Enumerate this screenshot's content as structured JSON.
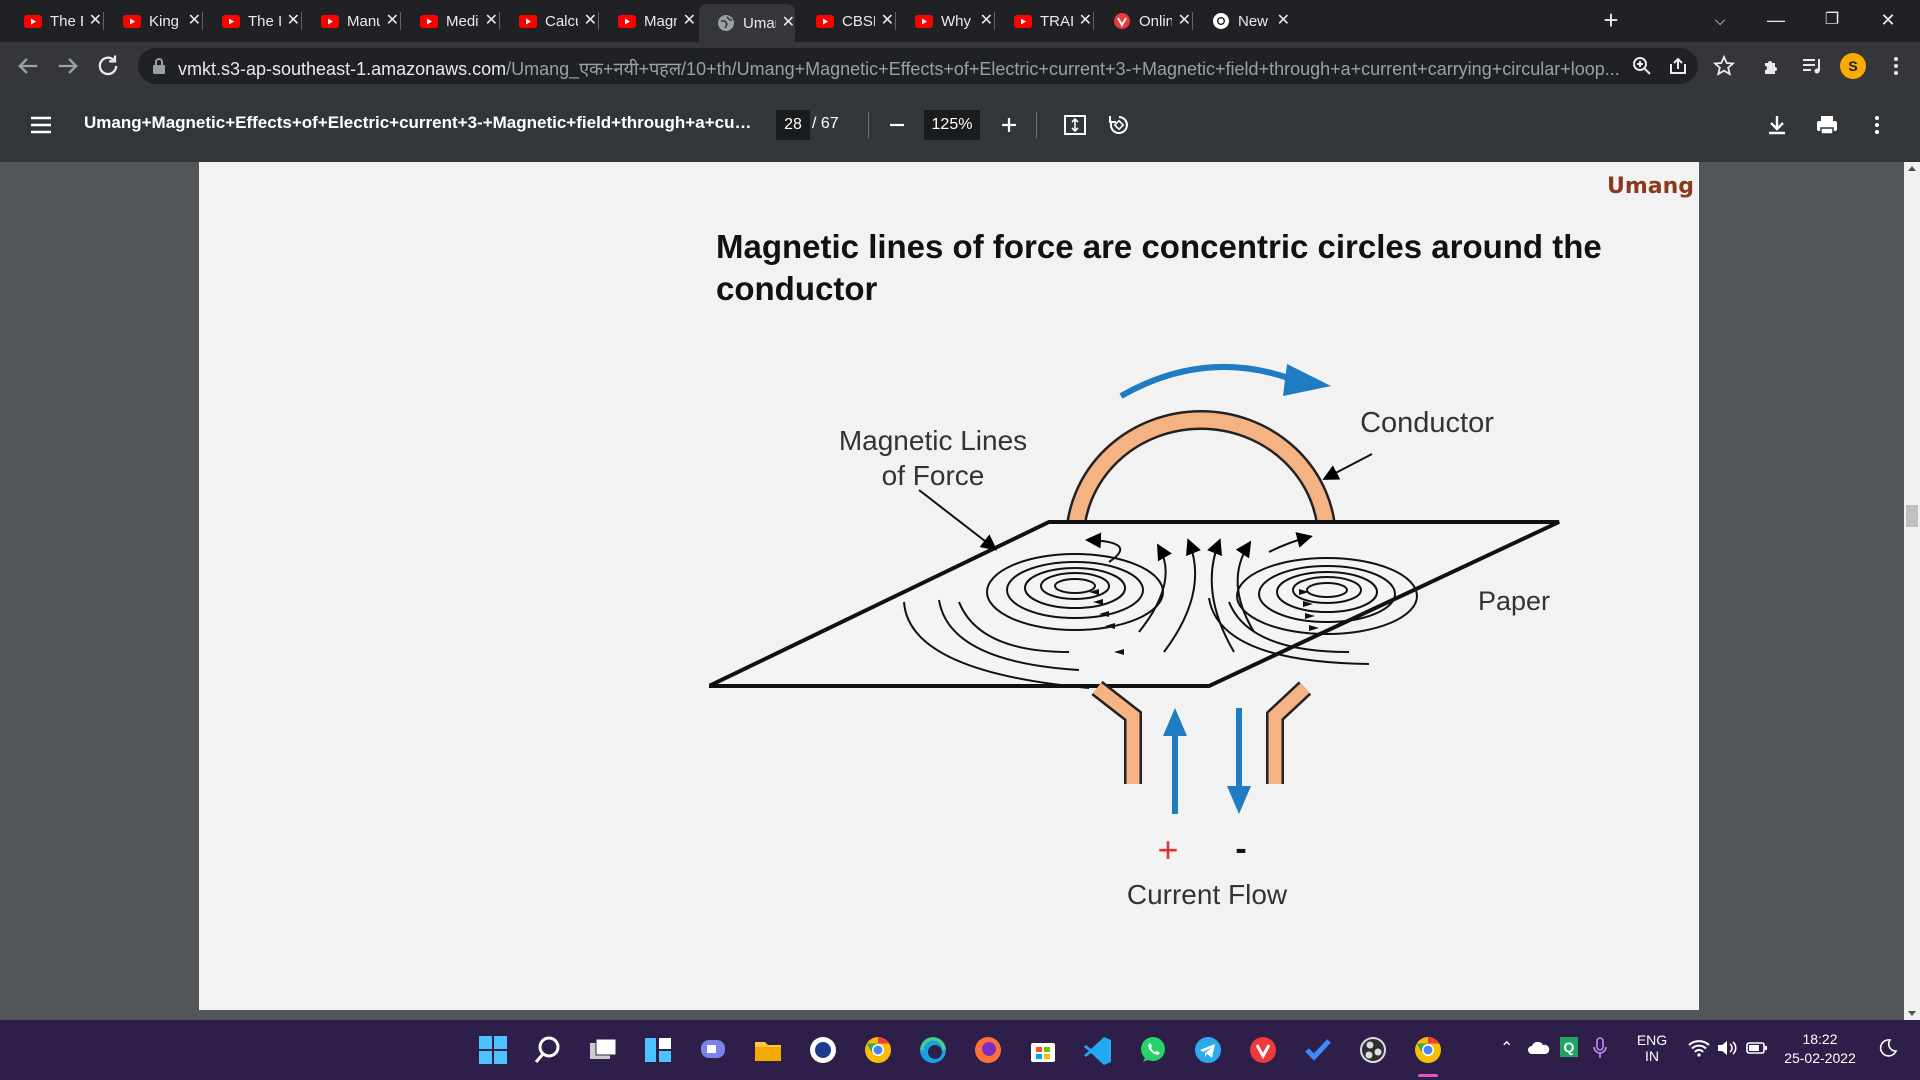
{
  "tabs": [
    {
      "title": "The Bi",
      "favicon": "youtube-icon"
    },
    {
      "title": "King K",
      "favicon": "youtube-icon"
    },
    {
      "title": "The In",
      "favicon": "youtube-icon"
    },
    {
      "title": "Manu",
      "favicon": "youtube-icon"
    },
    {
      "title": "Medit",
      "favicon": "youtube-icon"
    },
    {
      "title": "Calcul",
      "favicon": "youtube-icon"
    },
    {
      "title": "Magn",
      "favicon": "youtube-icon"
    },
    {
      "title": "Umang",
      "favicon": "globe-icon",
      "active": true
    },
    {
      "title": "CBSE",
      "favicon": "youtube-icon"
    },
    {
      "title": "Why A",
      "favicon": "youtube-icon"
    },
    {
      "title": "TRAIL",
      "favicon": "youtube-icon"
    },
    {
      "title": "Online",
      "favicon": "vivaldi-icon"
    },
    {
      "title": "New T",
      "favicon": "chrome-icon"
    }
  ],
  "address": {
    "host": "vmkt.s3-ap-southeast-1.amazonaws.com",
    "path": "/Umang_एक+नयी+पहल/10+th/Umang+Magnetic+Effects+of+Electric+current+3-+Magnetic+field+through+a+current+carrying+circular+loop..."
  },
  "profile": {
    "initial": "S"
  },
  "pdf": {
    "title": "Umang+Magnetic+Effects+of+Electric+current+3-+Magnetic+field+through+a+curre...",
    "current_page": "28",
    "total_pages": "/  67",
    "zoom": "125%"
  },
  "slide": {
    "logo": "Umang",
    "title": "Magnetic lines of force are concentric circles around the conductor",
    "diagram": {
      "label_lines": "Magnetic Lines of Force",
      "label_lines_1": "Magnetic Lines",
      "label_lines_2": "of Force",
      "label_conductor": "Conductor",
      "label_paper": "Paper",
      "plus": "+",
      "minus": "-",
      "label_current": "Current Flow"
    }
  },
  "colors": {
    "accent_orange": "#f5b383",
    "arrow_blue": "#1f7bc2",
    "taskbar": "#2d1f4a"
  },
  "system_tray": {
    "language": "ENG",
    "region": "IN",
    "time": "18:22",
    "date": "25-02-2022"
  }
}
